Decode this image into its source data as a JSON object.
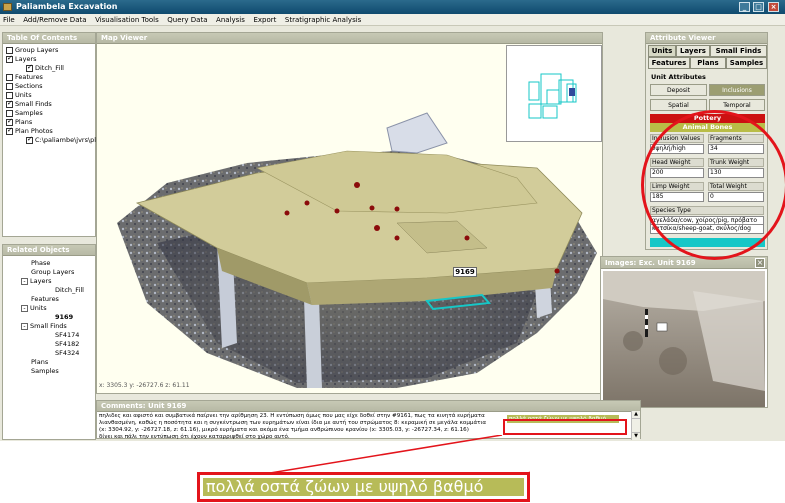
{
  "window": {
    "title": "Paliambela Excavation",
    "controls": [
      "_",
      "□",
      "×"
    ]
  },
  "menu": [
    "File",
    "Add/Remove Data",
    "Visualisation Tools",
    "Query Data",
    "Analysis",
    "Export",
    "Stratigraphic Analysis"
  ],
  "toc": {
    "title": "Table Of Contents",
    "items": [
      {
        "label": "Group Layers",
        "checked": false
      },
      {
        "label": "Layers",
        "checked": true
      },
      {
        "label": "Ditch_Fill",
        "checked": true
      },
      {
        "label": "Features",
        "checked": false
      },
      {
        "label": "Sections",
        "checked": false
      },
      {
        "label": "Units",
        "checked": false
      },
      {
        "label": "Small Finds",
        "checked": true
      },
      {
        "label": "Samples",
        "checked": false
      },
      {
        "label": "Plans",
        "checked": true
      },
      {
        "label": "Plan Photos",
        "checked": true
      },
      {
        "label": "C:\\paliambe\\jvrs\\pl",
        "checked": true
      }
    ]
  },
  "related": {
    "title": "Related Objects",
    "items": [
      "Phase",
      "Group Layers",
      "Layers",
      "Ditch_Fill",
      "Features",
      "Units",
      "9169",
      "Small Finds",
      "SF4174",
      "SF4182",
      "SF4324",
      "Plans",
      "Samples"
    ]
  },
  "map": {
    "title": "Map Viewer",
    "label_9169": "9169",
    "coords": "x: 3305.3   y: -26727.6   z: 61.11"
  },
  "comments": {
    "title": "Comments: Unit 9169",
    "line1": "πηλιδες και αφιστό και συμβατικά παίρνει την αρίθμηση 23. Η εντύπωση όμως που μας είχε δοθεί στην #9161, πως τα κινητά ευρήματα",
    "line2": "λιανθασμένη, καθώς η ποσότητα και η συγκέντρωση των ευρημάτων είναι ίδια με αυτή του στρώματος 8: κεραμική σε μεγάλα κομμάτια",
    "line3": "(x: 3304.92, y: -26727.18, z: 61.16), μικρό ευρήματα και ακόμα ένα τμήμα ανθρώπινου κρανίου (x: 3305.03, y: -26727.34, z: 61.16)",
    "line4": "δίνει και πάλι την εντύπωση ότι έχουν καταρριφθεί στο χώρο αυτό.",
    "highlight": "πολλά οστά ζώων με υψηλό βαθμό",
    "zoom_text": "πολλά οστά ζώων με υψηλό βαθμό"
  },
  "attr": {
    "title": "Attribute Viewer",
    "tabs": [
      "Units",
      "Layers",
      "Small Finds",
      "Features",
      "Plans",
      "Samples"
    ],
    "group_label": "Unit Attributes",
    "buttons": [
      "Deposit",
      "Inclusions",
      "Spatial",
      "Temporal"
    ],
    "pottery": "Pottery",
    "animal_bones": "Animal Bones",
    "inclusion_values_label": "Inclusion Values",
    "inclusion_values": "υψηλή/high",
    "fragments_label": "Fragments",
    "fragments": "34",
    "head_weight_label": "Head Weight",
    "head_weight": "200",
    "trunk_weight_label": "Trunk Weight",
    "trunk_weight": "130",
    "limb_weight_label": "Limp Weight",
    "limb_weight": "185",
    "total_weight_label": "Total Weight",
    "total_weight": "0",
    "species_label": "Species Type",
    "species_line1": "αγελάδα/cow, χοίρος/pig, πρόβατο",
    "species_line2": "κατσίκα/sheep-goat, σκύλος/dog"
  },
  "images": {
    "title": "Images: Exc. Unit 9169",
    "close": "×"
  },
  "colors": {
    "title_bar": "#1b5a7e",
    "pottery": "#cc1111",
    "animal_bones": "#b9bd47",
    "cyan": "#16c7c7",
    "annotation": "#e3141b"
  }
}
